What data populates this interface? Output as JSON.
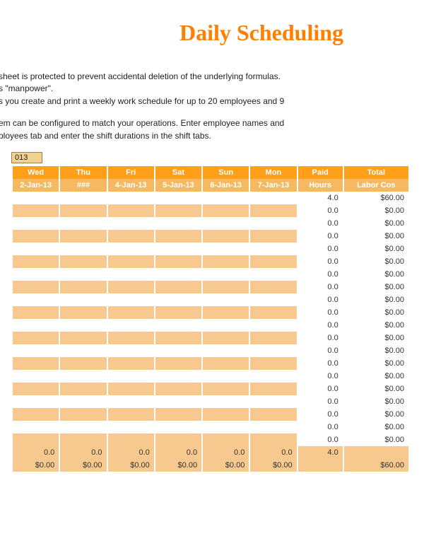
{
  "title": "Daily Scheduling",
  "intro": {
    "line1": "sheet is protected to prevent accidental deletion of the underlying formulas.",
    "line2": "s \"manpower\".",
    "line3": "s you create and print a weekly work schedule for up to 20 employees and 9",
    "line4": "em can be configured to match your operations. Enter employee names and",
    "line5": "ployees tab and enter the shift durations in the shift tabs."
  },
  "date_field": "013",
  "header_row1": [
    "Wed",
    "Thu",
    "Fri",
    "Sat",
    "Sun",
    "Mon",
    "Paid",
    "Total"
  ],
  "header_row2": [
    "2-Jan-13",
    "###",
    "4-Jan-13",
    "5-Jan-13",
    "6-Jan-13",
    "7-Jan-13",
    "Hours",
    "Labor Cos"
  ],
  "rows": [
    {
      "days": [
        "",
        "",
        "",
        "",
        "",
        ""
      ],
      "paid": "4.0",
      "total": "$60.00"
    },
    {
      "days": [
        "",
        "",
        "",
        "",
        "",
        ""
      ],
      "paid": "0.0",
      "total": "$0.00"
    },
    {
      "days": [
        "",
        "",
        "",
        "",
        "",
        ""
      ],
      "paid": "0.0",
      "total": "$0.00"
    },
    {
      "days": [
        "",
        "",
        "",
        "",
        "",
        ""
      ],
      "paid": "0.0",
      "total": "$0.00"
    },
    {
      "days": [
        "",
        "",
        "",
        "",
        "",
        ""
      ],
      "paid": "0.0",
      "total": "$0.00"
    },
    {
      "days": [
        "",
        "",
        "",
        "",
        "",
        ""
      ],
      "paid": "0.0",
      "total": "$0.00"
    },
    {
      "days": [
        "",
        "",
        "",
        "",
        "",
        ""
      ],
      "paid": "0.0",
      "total": "$0.00"
    },
    {
      "days": [
        "",
        "",
        "",
        "",
        "",
        ""
      ],
      "paid": "0.0",
      "total": "$0.00"
    },
    {
      "days": [
        "",
        "",
        "",
        "",
        "",
        ""
      ],
      "paid": "0.0",
      "total": "$0.00"
    },
    {
      "days": [
        "",
        "",
        "",
        "",
        "",
        ""
      ],
      "paid": "0.0",
      "total": "$0.00"
    },
    {
      "days": [
        "",
        "",
        "",
        "",
        "",
        ""
      ],
      "paid": "0.0",
      "total": "$0.00"
    },
    {
      "days": [
        "",
        "",
        "",
        "",
        "",
        ""
      ],
      "paid": "0.0",
      "total": "$0.00"
    },
    {
      "days": [
        "",
        "",
        "",
        "",
        "",
        ""
      ],
      "paid": "0.0",
      "total": "$0.00"
    },
    {
      "days": [
        "",
        "",
        "",
        "",
        "",
        ""
      ],
      "paid": "0.0",
      "total": "$0.00"
    },
    {
      "days": [
        "",
        "",
        "",
        "",
        "",
        ""
      ],
      "paid": "0.0",
      "total": "$0.00"
    },
    {
      "days": [
        "",
        "",
        "",
        "",
        "",
        ""
      ],
      "paid": "0.0",
      "total": "$0.00"
    },
    {
      "days": [
        "",
        "",
        "",
        "",
        "",
        ""
      ],
      "paid": "0.0",
      "total": "$0.00"
    },
    {
      "days": [
        "",
        "",
        "",
        "",
        "",
        ""
      ],
      "paid": "0.0",
      "total": "$0.00"
    },
    {
      "days": [
        "",
        "",
        "",
        "",
        "",
        ""
      ],
      "paid": "0.0",
      "total": "$0.00"
    },
    {
      "days": [
        "",
        "",
        "",
        "",
        "",
        ""
      ],
      "paid": "0.0",
      "total": "$0.00"
    }
  ],
  "footer_hours": {
    "days": [
      "0.0",
      "0.0",
      "0.0",
      "0.0",
      "0.0",
      "0.0"
    ],
    "paid": "4.0",
    "total": ""
  },
  "footer_cost": {
    "days": [
      "$0.00",
      "$0.00",
      "$0.00",
      "$0.00",
      "$0.00",
      "$0.00"
    ],
    "paid": "",
    "total": "$60.00"
  }
}
